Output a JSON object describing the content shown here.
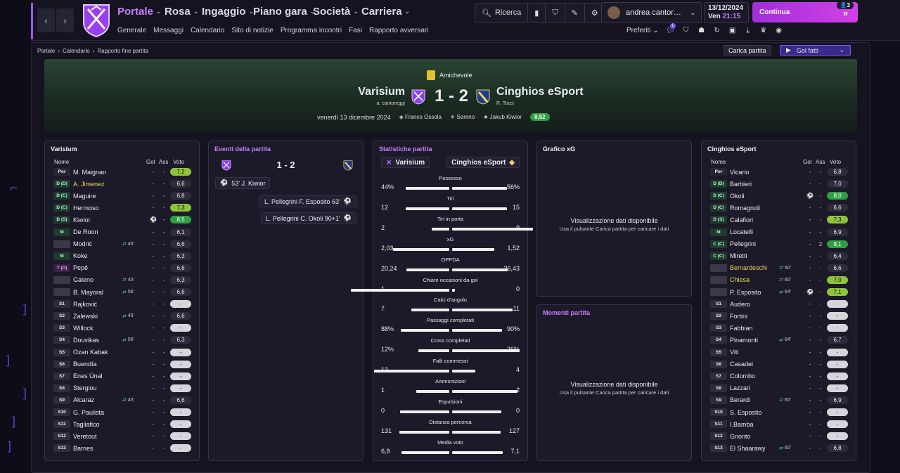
{
  "nav": {
    "back": "‹",
    "forward": "›"
  },
  "menu": [
    {
      "label": "Portale",
      "active": true
    },
    {
      "label": "Rosa"
    },
    {
      "label": "Ingaggio"
    },
    {
      "label": "Piano gara"
    },
    {
      "label": "Società"
    },
    {
      "label": "Carriera"
    }
  ],
  "submenu": [
    "Generale",
    "Messaggi",
    "Calendario",
    "Sito di notizie",
    "Programma incontri",
    "Fasi",
    "Rapporto avversari"
  ],
  "toolbar": {
    "search_label": "Ricerca"
  },
  "user": {
    "name": "andrea cantor…"
  },
  "date": {
    "date": "13/12/2024",
    "day": "Ven",
    "time": "21:15"
  },
  "continue": {
    "label": "Continua",
    "badge": "3"
  },
  "favorites": {
    "label": "Preferiti",
    "notif": "1"
  },
  "breadcrumb": [
    "Portale",
    "Calendario",
    "Rapporto fine partita"
  ],
  "actions": {
    "load_match": "Carica partita",
    "goals_select": "Gol fatti"
  },
  "match": {
    "competition": "Amichevole",
    "home": "Varisium",
    "home_manager": "a. cantoreggi",
    "away": "Cinghios eSport",
    "away_manager": "R. Tocci",
    "score": "1 - 2",
    "date": "venerdì 13 dicembre 2024",
    "referee": "Franco Ossola",
    "weather": "Sereno",
    "motm": "Jakub Kiwior",
    "motm_rating": "8,52"
  },
  "home_panel": {
    "title": "Varisium",
    "headers": {
      "name": "Nome",
      "gol": "Gol",
      "ass": "Ass",
      "vote": "Voto"
    },
    "players": [
      {
        "pos": "Por",
        "name": "M. Maignan",
        "sub": "",
        "gol": "-",
        "ass": "-",
        "vote": "7,2",
        "cls": "g2"
      },
      {
        "pos": "D (D)",
        "name": "A. Jimenez",
        "y": true,
        "sub": "",
        "gol": "-",
        "ass": "-",
        "vote": "6,6"
      },
      {
        "pos": "D (C)",
        "name": "Maguire",
        "sub": "",
        "gol": "-",
        "ass": "-",
        "vote": "6,8"
      },
      {
        "pos": "D (C)",
        "name": "Hermoso",
        "sub": "",
        "gol": "-",
        "ass": "-",
        "vote": "7,3",
        "cls": "g2"
      },
      {
        "pos": "D (S)",
        "name": "Kiwior",
        "sub": "",
        "gol": "⚽",
        "ass": "-",
        "vote": "8,5",
        "cls": "g1"
      },
      {
        "pos": "M",
        "name": "De Roon",
        "sub": "",
        "gol": "-",
        "ass": "-",
        "vote": "6,1"
      },
      {
        "pos": "",
        "name": "Modrić",
        "sub": "45'",
        "gol": "-",
        "ass": "-",
        "vote": "6,6"
      },
      {
        "pos": "M",
        "name": "Koke",
        "sub": "",
        "gol": "-",
        "ass": "-",
        "vote": "6,3"
      },
      {
        "pos": "T (D)",
        "name": "Pepê",
        "sub": "",
        "gol": "-",
        "ass": "-",
        "vote": "6,6"
      },
      {
        "pos": "",
        "name": "Galeno",
        "sub": "45'",
        "gol": "-",
        "ass": "-",
        "vote": "6,3"
      },
      {
        "pos": "",
        "name": "B. Mayoral",
        "sub": "56'",
        "gol": "-",
        "ass": "-",
        "vote": "6,6"
      },
      {
        "pos": "S1",
        "name": "Rajković",
        "sub": "",
        "gol": "-",
        "ass": "-",
        "vote": "-",
        "cls": "dash"
      },
      {
        "pos": "S2",
        "name": "Zalewski",
        "sub": "45'",
        "gol": "-",
        "ass": "-",
        "vote": "6,6"
      },
      {
        "pos": "S3",
        "name": "Willock",
        "sub": "",
        "gol": "-",
        "ass": "-",
        "vote": "-",
        "cls": "dash"
      },
      {
        "pos": "S4",
        "name": "Douvikas",
        "sub": "56'",
        "gol": "-",
        "ass": "-",
        "vote": "6,3"
      },
      {
        "pos": "S5",
        "name": "Ozan Kabak",
        "sub": "",
        "gol": "-",
        "ass": "-",
        "vote": "-",
        "cls": "dash"
      },
      {
        "pos": "S6",
        "name": "Buendía",
        "sub": "",
        "gol": "-",
        "ass": "-",
        "vote": "-",
        "cls": "dash"
      },
      {
        "pos": "S7",
        "name": "Enes Ünal",
        "sub": "",
        "gol": "-",
        "ass": "-",
        "vote": "-",
        "cls": "dash"
      },
      {
        "pos": "S8",
        "name": "Stergiou",
        "sub": "",
        "gol": "-",
        "ass": "-",
        "vote": "-",
        "cls": "dash"
      },
      {
        "pos": "S9",
        "name": "Alcaraz",
        "sub": "45'",
        "gol": "-",
        "ass": "-",
        "vote": "6,6"
      },
      {
        "pos": "S10",
        "name": "G. Paulista",
        "sub": "",
        "gol": "-",
        "ass": "-",
        "vote": "-",
        "cls": "dash"
      },
      {
        "pos": "S11",
        "name": "Tagliafico",
        "sub": "",
        "gol": "-",
        "ass": "-",
        "vote": "-",
        "cls": "dash"
      },
      {
        "pos": "S12",
        "name": "Veretout",
        "sub": "",
        "gol": "-",
        "ass": "-",
        "vote": "-",
        "cls": "dash"
      },
      {
        "pos": "S13",
        "name": "Barnes",
        "sub": "",
        "gol": "-",
        "ass": "-",
        "vote": "-",
        "cls": "dash"
      }
    ]
  },
  "events": {
    "title": "Eventi della partita",
    "score": "1 - 2",
    "list": [
      {
        "side": "home",
        "text": "53' J. Kiwior"
      },
      {
        "side": "away",
        "text": "L. Pellegrini F. Esposito 63'"
      },
      {
        "side": "away",
        "text": "L. Pellegrini C. Okoli 90+1'"
      }
    ]
  },
  "stats": {
    "title": "Statistiche partita",
    "home": "Varisium",
    "away": "Cinghios eSport",
    "rows": [
      {
        "label": "Possesso",
        "h": "44%",
        "a": "56%",
        "hv": 44,
        "av": 56
      },
      {
        "label": "Tiri",
        "h": "12",
        "a": "15",
        "hv": 12,
        "av": 15
      },
      {
        "label": "Tiri in porta",
        "h": "2",
        "a": "9",
        "hv": 2,
        "av": 9
      },
      {
        "label": "xG",
        "h": "2,03",
        "a": "1,52",
        "hv": 2.03,
        "av": 1.52
      },
      {
        "label": "OPPDA",
        "h": "20,24",
        "a": "26,43",
        "hv": 20.24,
        "av": 26.43
      },
      {
        "label": "Chiare occasioni da gol",
        "h": "1",
        "a": "0",
        "hv": 1,
        "av": 0
      },
      {
        "label": "Calci d'angolo",
        "h": "7",
        "a": "11",
        "hv": 7,
        "av": 11
      },
      {
        "label": "Passaggi completati",
        "h": "88%",
        "a": "90%",
        "hv": 88,
        "av": 90
      },
      {
        "label": "Cross completati",
        "h": "12%",
        "a": "26%",
        "hv": 12,
        "av": 26
      },
      {
        "label": "Falli commessi",
        "h": "13",
        "a": "4",
        "hv": 13,
        "av": 4
      },
      {
        "label": "Ammonizioni",
        "h": "1",
        "a": "2",
        "hv": 1,
        "av": 2
      },
      {
        "label": "Espulsioni",
        "h": "0",
        "a": "0",
        "hv": 0,
        "av": 0
      },
      {
        "label": "Distanza percorsa",
        "h": "131",
        "a": "127",
        "hv": 131,
        "av": 127
      },
      {
        "label": "Media voto",
        "h": "6,8",
        "a": "7,1",
        "hv": 6.8,
        "av": 7.1
      }
    ]
  },
  "xg_panel": {
    "title": "Grafico xG",
    "msg": "Visualizzazione dati disponibile",
    "hint": "Usa il pulsante Carica partita per caricare i dati"
  },
  "moments_panel": {
    "title": "Momenti partita",
    "msg": "Visualizzazione dati disponibile",
    "hint": "Usa il pulsante Carica partita per caricare i dati"
  },
  "away_panel": {
    "title": "Cinghios eSport",
    "headers": {
      "name": "Nome",
      "gol": "Gol",
      "ass": "Ass",
      "vote": "Voto"
    },
    "players": [
      {
        "pos": "Por",
        "name": "Vicario",
        "sub": "",
        "gol": "-",
        "ass": "-",
        "vote": "6,8"
      },
      {
        "pos": "D (D)",
        "name": "Barbieri",
        "sub": "",
        "gol": "-",
        "ass": "-",
        "vote": "7,0"
      },
      {
        "pos": "D (C)",
        "name": "Okoli",
        "sub": "",
        "gol": "⚽",
        "ass": "-",
        "vote": "8,0",
        "cls": "g1"
      },
      {
        "pos": "D (C)",
        "name": "Romagnoli",
        "sub": "",
        "gol": "-",
        "ass": "-",
        "vote": "6,6"
      },
      {
        "pos": "D (S)",
        "name": "Calafiori",
        "sub": "",
        "gol": "-",
        "ass": "-",
        "vote": "7,3",
        "cls": "g2"
      },
      {
        "pos": "M",
        "name": "Locatelli",
        "sub": "",
        "gol": "-",
        "ass": "-",
        "vote": "6,9"
      },
      {
        "pos": "C (C)",
        "name": "Pellegrini",
        "sub": "",
        "gol": "-",
        "ass": "2",
        "vote": "8,1",
        "cls": "g1"
      },
      {
        "pos": "C (C)",
        "name": "Miretti",
        "sub": "",
        "gol": "-",
        "ass": "-",
        "vote": "6,4"
      },
      {
        "pos": "",
        "name": "Bernardeschi",
        "y": true,
        "sub": "60'",
        "gol": "-",
        "ass": "-",
        "vote": "6,6"
      },
      {
        "pos": "",
        "name": "Chiesa",
        "y": true,
        "sub": "60'",
        "gol": "-",
        "ass": "-",
        "vote": "7,0",
        "cls": "g2"
      },
      {
        "pos": "",
        "name": "P. Esposito",
        "sub": "64'",
        "gol": "⚽",
        "ass": "-",
        "vote": "7,1",
        "cls": "g2"
      },
      {
        "pos": "S1",
        "name": "Audero",
        "sub": "",
        "gol": "-",
        "ass": "-",
        "vote": "-",
        "cls": "dash"
      },
      {
        "pos": "S2",
        "name": "Fortini",
        "sub": "",
        "gol": "-",
        "ass": "-",
        "vote": "-",
        "cls": "dash"
      },
      {
        "pos": "S3",
        "name": "Fabbian",
        "sub": "",
        "gol": "-",
        "ass": "-",
        "vote": "-",
        "cls": "dash"
      },
      {
        "pos": "S4",
        "name": "Pinamonti",
        "sub": "64'",
        "gol": "-",
        "ass": "-",
        "vote": "6,7"
      },
      {
        "pos": "S5",
        "name": "Viti",
        "sub": "",
        "gol": "-",
        "ass": "-",
        "vote": "-",
        "cls": "dash"
      },
      {
        "pos": "S6",
        "name": "Casadei",
        "sub": "",
        "gol": "-",
        "ass": "-",
        "vote": "-",
        "cls": "dash"
      },
      {
        "pos": "S7",
        "name": "Colombo",
        "sub": "",
        "gol": "-",
        "ass": "-",
        "vote": "-",
        "cls": "dash"
      },
      {
        "pos": "S8",
        "name": "Lazzari",
        "sub": "",
        "gol": "-",
        "ass": "-",
        "vote": "-",
        "cls": "dash"
      },
      {
        "pos": "S9",
        "name": "Berardi",
        "sub": "60'",
        "gol": "-",
        "ass": "-",
        "vote": "6,9"
      },
      {
        "pos": "S10",
        "name": "S. Esposito",
        "sub": "",
        "gol": "-",
        "ass": "-",
        "vote": "-",
        "cls": "dash"
      },
      {
        "pos": "S11",
        "name": "I.Bamba",
        "sub": "",
        "gol": "-",
        "ass": "-",
        "vote": "-",
        "cls": "dash"
      },
      {
        "pos": "S12",
        "name": "Gnonto",
        "sub": "",
        "gol": "-",
        "ass": "-",
        "vote": "-",
        "cls": "dash"
      },
      {
        "pos": "S13",
        "name": "El Shaarawy",
        "sub": "60'",
        "gol": "-",
        "ass": "-",
        "vote": "6,8"
      }
    ]
  }
}
